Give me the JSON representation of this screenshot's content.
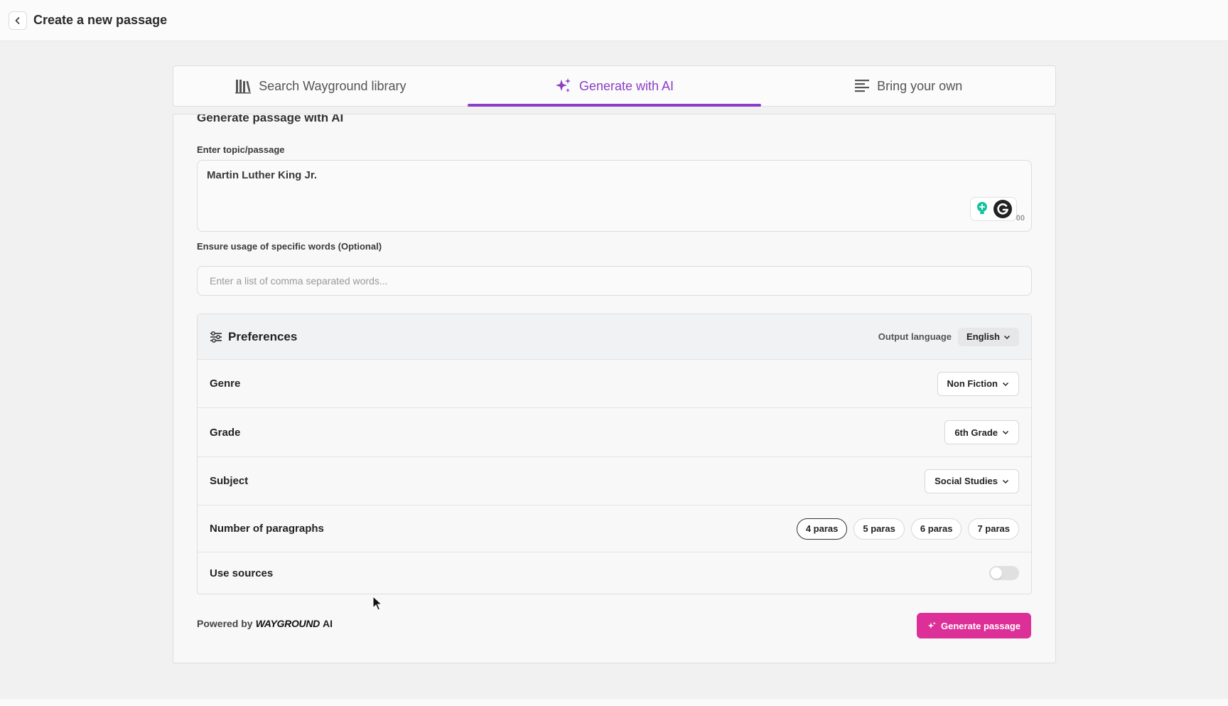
{
  "header": {
    "title": "Create a new passage"
  },
  "tabs": [
    {
      "label": "Search Wayground library",
      "icon": "books-icon"
    },
    {
      "label": "Generate with AI",
      "icon": "sparkles-icon",
      "active": true
    },
    {
      "label": "Bring your own",
      "icon": "text-lines-icon"
    }
  ],
  "form": {
    "section_heading": "Generate passage with AI",
    "topic_label": "Enter topic/passage",
    "topic_value": "Martin Luther King Jr.",
    "counter": "00",
    "words_label": "Ensure usage of specific words (Optional)",
    "words_placeholder": "Enter a list of comma separated words..."
  },
  "preferences": {
    "title": "Preferences",
    "output_language_label": "Output language",
    "output_language": "English",
    "rows": {
      "genre": {
        "label": "Genre",
        "value": "Non Fiction"
      },
      "grade": {
        "label": "Grade",
        "value": "6th Grade"
      },
      "subject": {
        "label": "Subject",
        "value": "Social Studies"
      },
      "paragraphs": {
        "label": "Number of paragraphs",
        "options": [
          "4 paras",
          "5 paras",
          "6 paras",
          "7 paras"
        ],
        "selected": "4 paras"
      },
      "sources": {
        "label": "Use sources",
        "enabled": false
      }
    }
  },
  "footer": {
    "powered_by": "Powered by",
    "brand": "WAYGROUND",
    "brand_suffix": "AI",
    "generate_label": "Generate passage"
  },
  "colors": {
    "accent_purple": "#8b3fc6",
    "generate_pink": "#dc2f97",
    "grammar_green": "#15c39a"
  }
}
